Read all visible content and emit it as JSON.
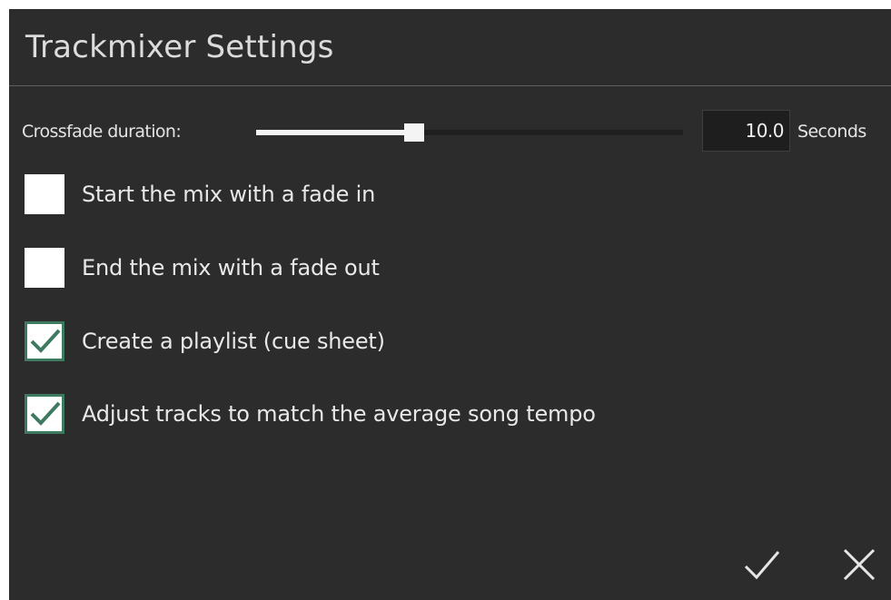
{
  "dialog": {
    "title": "Trackmixer Settings"
  },
  "crossfade": {
    "label": "Crossfade duration:",
    "value": "10.0",
    "units": "Seconds",
    "slider_fraction": 0.36
  },
  "options": [
    {
      "label": "Start the mix with a fade in",
      "checked": false
    },
    {
      "label": "End the mix with a fade out",
      "checked": false
    },
    {
      "label": "Create a playlist (cue sheet)",
      "checked": true
    },
    {
      "label": "Adjust tracks to match the average song tempo",
      "checked": true
    }
  ],
  "actions": {
    "confirm_icon": "checkmark-icon",
    "cancel_icon": "close-icon"
  },
  "colors": {
    "background": "#2b2c2b",
    "checkbox_accent": "#3e7a5f",
    "text": "#e8e8e8"
  }
}
